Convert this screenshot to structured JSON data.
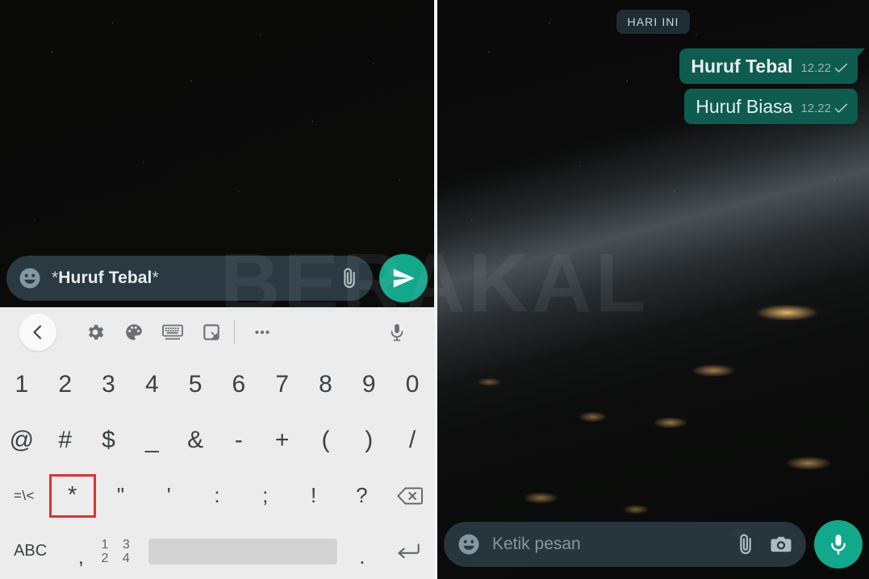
{
  "watermark": {
    "text": "BERAKAL"
  },
  "left_panel": {
    "input_bar": {
      "emoji_icon": "smiley-icon",
      "text_value": "*Huruf Tebal*",
      "text_prefix_asterisk": "*",
      "text_core": "Huruf Tebal",
      "text_suffix_asterisk": "*",
      "attach_icon": "paperclip-icon",
      "send_icon": "send-icon",
      "send_color": "#11a88b",
      "field_color": "#2a3942"
    },
    "keyboard": {
      "background": "#ececed",
      "toolbar": [
        {
          "name": "back-icon",
          "glyph": "chevron-left"
        },
        {
          "name": "settings-gear-icon",
          "glyph": "gear"
        },
        {
          "name": "theme-palette-icon",
          "glyph": "palette"
        },
        {
          "name": "keyboard-layout-icon",
          "glyph": "keyboard"
        },
        {
          "name": "one-handed-mode-icon",
          "glyph": "resize"
        },
        {
          "name": "more-options-icon",
          "glyph": "ellipsis"
        },
        {
          "name": "voice-input-icon",
          "glyph": "microphone"
        }
      ],
      "row_numbers": [
        "1",
        "2",
        "3",
        "4",
        "5",
        "6",
        "7",
        "8",
        "9",
        "0"
      ],
      "row_symbols": [
        "@",
        "#",
        "$",
        "_",
        "&",
        "-",
        "+",
        "(",
        ")",
        "/"
      ],
      "row_punctuation": [
        "=\\<",
        "*",
        "\"",
        "'",
        ":",
        ";",
        "!",
        "?",
        "backspace-icon"
      ],
      "row_bottom": {
        "abc_label": "ABC",
        "comma_label": ",",
        "numeric_label_top": "1 2",
        "numeric_label_bottom": "3 4",
        "space_label": "",
        "period_label": ".",
        "enter_icon": "enter-icon"
      },
      "highlighted_key": "*",
      "highlight_color": "#e03131"
    }
  },
  "right_panel": {
    "date_divider": "HARI INI",
    "messages": [
      {
        "text": "Huruf Tebal",
        "bold": true,
        "time": "12.22",
        "status_icon": "single-check-icon"
      },
      {
        "text": "Huruf Biasa",
        "bold": false,
        "time": "12.22",
        "status_icon": "single-check-icon"
      }
    ],
    "input_bar": {
      "emoji_icon": "smiley-icon",
      "placeholder": "Ketik pesan",
      "attach_icon": "paperclip-icon",
      "camera_icon": "camera-icon",
      "mic_icon": "microphone-icon",
      "mic_color": "#11a88b",
      "field_color": "#2a3942"
    },
    "bubble_color": "#0d5c4f",
    "date_pill_color": "#1f2c33"
  }
}
